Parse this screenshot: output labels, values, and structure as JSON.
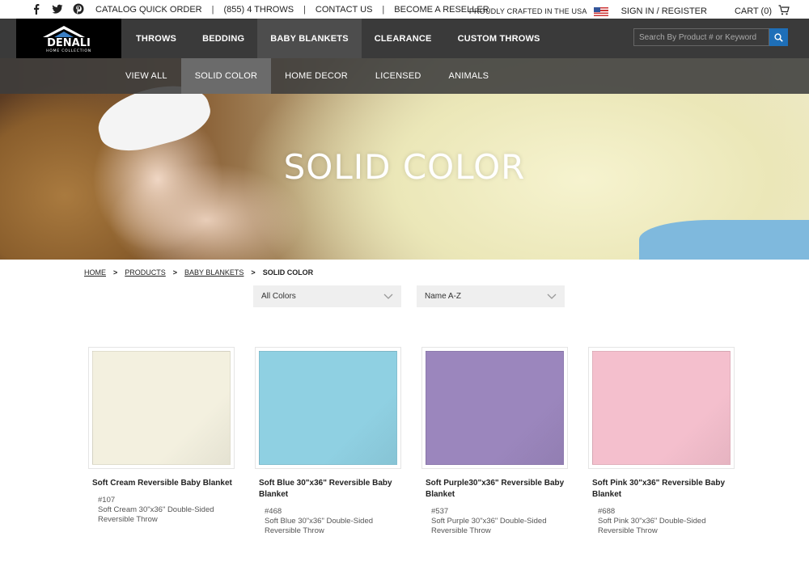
{
  "topbar": {
    "social_icons": [
      "facebook-icon",
      "twitter-icon",
      "pinterest-icon"
    ],
    "catalog_quick_order": "CATALOG QUICK ORDER",
    "phone": "(855) 4 THROWS",
    "contact_us": "CONTACT US",
    "become_reseller": "BECOME A RESELLER",
    "separator": "|",
    "crafted": "PROUDLY CRAFTED IN THE USA",
    "sign_in": "SIGN IN / REGISTER",
    "cart": "CART (0)"
  },
  "logo": {
    "brand": "DENALI",
    "sub": "HOME COLLECTION"
  },
  "mainnav": {
    "items": [
      {
        "label": "THROWS",
        "active": false
      },
      {
        "label": "BEDDING",
        "active": false
      },
      {
        "label": "BABY BLANKETS",
        "active": true
      },
      {
        "label": "CLEARANCE",
        "active": false
      },
      {
        "label": "CUSTOM THROWS",
        "active": false
      }
    ],
    "search_placeholder": "Search By Product # or Keyword"
  },
  "subnav": {
    "items": [
      {
        "label": "VIEW ALL",
        "active": false
      },
      {
        "label": "SOLID COLOR",
        "active": true
      },
      {
        "label": "HOME DECOR",
        "active": false
      },
      {
        "label": "LICENSED",
        "active": false
      },
      {
        "label": "ANIMALS",
        "active": false
      }
    ]
  },
  "hero": {
    "title": "SOLID COLOR"
  },
  "breadcrumb": {
    "home": "HOME",
    "products": "PRODUCTS",
    "baby_blankets": "BABY BLANKETS",
    "current": "SOLID COLOR",
    "arrow": ">"
  },
  "filters": {
    "color_selected": "All Colors",
    "sort_selected": "Name A-Z"
  },
  "products": [
    {
      "title": "Soft Cream Reversible Baby Blanket",
      "sku": "#107",
      "desc": "Soft Cream 30\"x36\" Double-Sided Reversible Throw",
      "color": "#f3f0df"
    },
    {
      "title": "Soft Blue 30\"x36\" Reversible Baby Blanket",
      "sku": "#468",
      "desc": "Soft Blue 30\"x36\" Double-Sided Reversible Throw",
      "color": "#8fd0e2"
    },
    {
      "title": "Soft Purple30\"x36\" Reversible Baby Blanket",
      "sku": "#537",
      "desc": "Soft Purple 30\"x36\" Double-Sided Reversible Throw",
      "color": "#9b86bd"
    },
    {
      "title": "Soft Pink 30\"x36\" Reversible Baby Blanket",
      "sku": "#688",
      "desc": "Soft Pink 30\"x36\" Double-Sided Reversible Throw",
      "color": "#f4bfcd"
    }
  ],
  "colors": {
    "nav_bg": "#3a3a3a",
    "search_button": "#1e6fb8"
  }
}
